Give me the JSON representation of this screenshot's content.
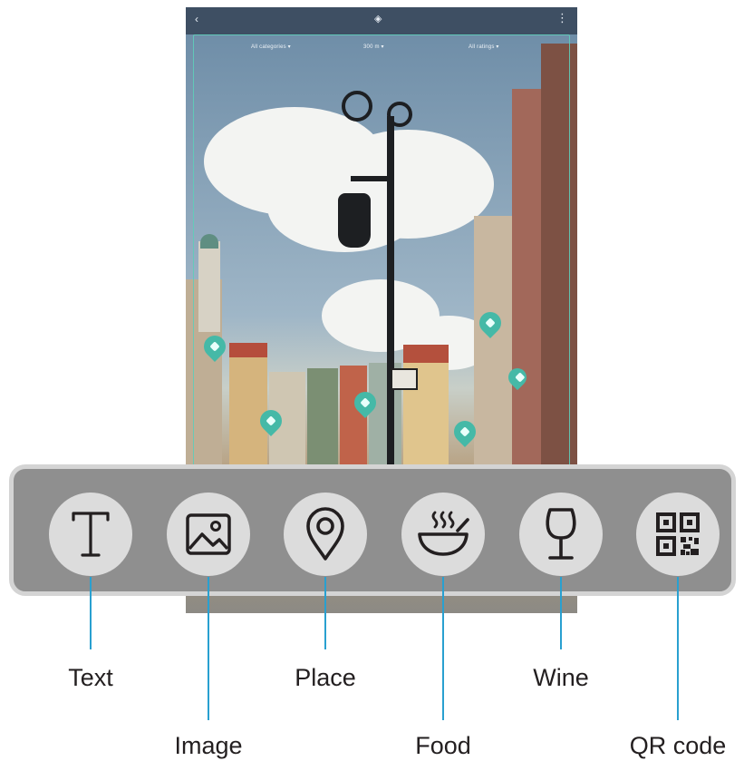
{
  "status_bar": {
    "back_icon": "chevron-left",
    "center_icon": "bixby-vision-icon",
    "more_icon": "more-vertical"
  },
  "filters": [
    "All categories ▾",
    "300 m ▾",
    "All ratings ▾"
  ],
  "modes": [
    {
      "id": "text",
      "label": "Text",
      "icon": "text-icon"
    },
    {
      "id": "image",
      "label": "Image",
      "icon": "image-icon"
    },
    {
      "id": "place",
      "label": "Place",
      "icon": "location-pin-icon"
    },
    {
      "id": "food",
      "label": "Food",
      "icon": "bowl-icon"
    },
    {
      "id": "wine",
      "label": "Wine",
      "icon": "wine-glass-icon"
    },
    {
      "id": "qr",
      "label": "QR code",
      "icon": "qr-code-icon"
    }
  ],
  "colors": {
    "accent_line": "#29a0d0",
    "pin": "#45b9a7",
    "button_bg": "#dcdcdc",
    "bar_bg": "#8f8f8f",
    "bar_border": "#d4d4d4"
  }
}
